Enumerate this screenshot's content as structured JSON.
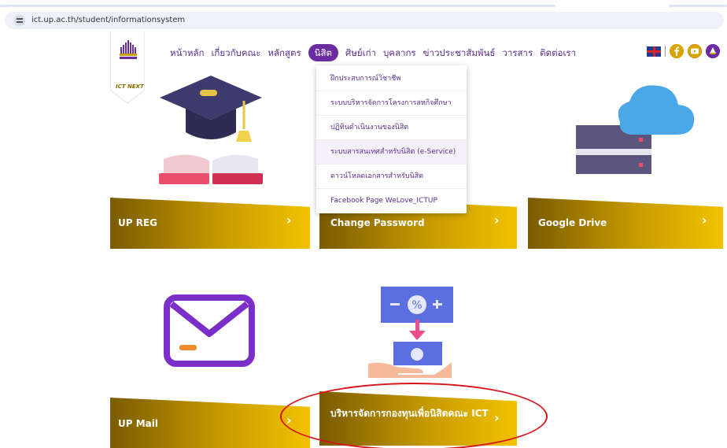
{
  "browser": {
    "url": "ict.up.ac.th/student/informationsystem"
  },
  "logo": {
    "subtitle": "ICT NEXT"
  },
  "nav": {
    "items": [
      {
        "label": "หน้าหลัก",
        "active": false
      },
      {
        "label": "เกี่ยวกับคณะ",
        "active": false
      },
      {
        "label": "หลักสูตร",
        "active": false
      },
      {
        "label": "นิสิต",
        "active": true
      },
      {
        "label": "ศิษย์เก่า",
        "active": false
      },
      {
        "label": "บุคลากร",
        "active": false
      },
      {
        "label": "ข่าวประชาสัมพันธ์",
        "active": false
      },
      {
        "label": "วารสาร",
        "active": false
      },
      {
        "label": "ติดต่อเรา",
        "active": false
      }
    ],
    "tools": [
      "uk-flag-icon",
      "facebook-icon",
      "youtube-icon",
      "up-logo-icon"
    ]
  },
  "dropdown": {
    "items": [
      {
        "label": "ฝึกประสบการณ์วิชาชีพ",
        "highlighted": false
      },
      {
        "label": "ระบบบริหารจัดการโครงการสหกิจศึกษา",
        "highlighted": false
      },
      {
        "label": "ปฏิทินดำเนินงานของนิสิต",
        "highlighted": false
      },
      {
        "label": "ระบบสารสนเทศสำหรับนิสิต (e-Service)",
        "highlighted": true
      },
      {
        "label": "ดาวน์โหลดเอกสารสำหรับนิสิต",
        "highlighted": false
      },
      {
        "label": "Facebook Page WeLove_ICTUP",
        "highlighted": false
      }
    ]
  },
  "cards": [
    {
      "label": "UP REG",
      "icon": "graduation-book-icon"
    },
    {
      "label": "Change Password",
      "icon": "password-icon"
    },
    {
      "label": "Google Drive",
      "icon": "cloud-server-icon"
    },
    {
      "label": "UP Mail",
      "icon": "mail-icon"
    },
    {
      "label": "บริหารจัดการกองทุนเพื่อนิสิตคณะ ICT",
      "icon": "fund-hand-icon"
    }
  ],
  "arrow_glyph": "›",
  "colors": {
    "brand_purple": "#6a2ca0",
    "gold_dark": "#7a5b00",
    "gold_light": "#f2c200",
    "callout_red": "#d7141a"
  }
}
